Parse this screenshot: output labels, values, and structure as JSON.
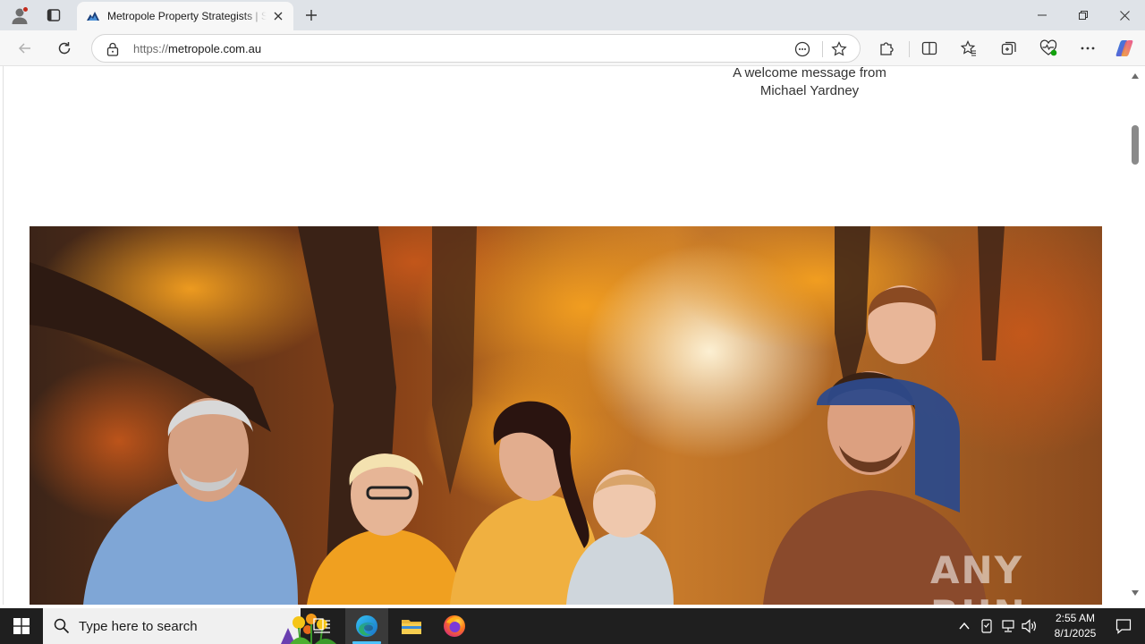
{
  "browser": {
    "tab": {
      "title": "Metropole Property Strategists | Sydney, Melbourne, Brisbane",
      "favicon": "metropole-logo-icon"
    },
    "address": {
      "scheme": "https://",
      "host": "metropole.com.au"
    },
    "colors": {
      "tabstrip": "#dfe3e8",
      "toolbar": "#f7f7f7",
      "copilot_accent": "#2b88d8"
    }
  },
  "page": {
    "welcome_line1": "A welcome message from",
    "welcome_line2": "Michael Yardney",
    "hero_image": "family-autumn-park-photo",
    "watermark": "ANY RUN"
  },
  "taskbar": {
    "search_placeholder": "Type here to search",
    "time": "2:55 AM",
    "date": "8/1/2025",
    "apps": [
      "task-view-icon",
      "edge-icon",
      "file-explorer-icon",
      "firefox-icon"
    ],
    "active_color": "#4cc2ff"
  }
}
